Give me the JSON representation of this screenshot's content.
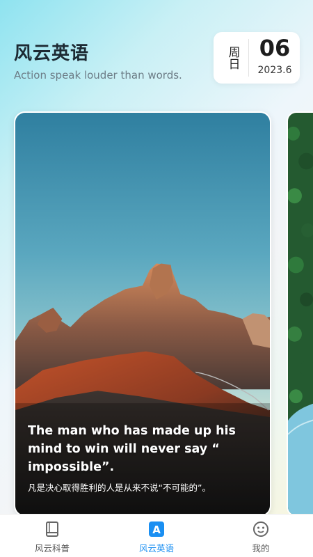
{
  "header": {
    "title": "风云英语",
    "subtitle": "Action speak louder than words."
  },
  "date_card": {
    "weekday": "周日",
    "day": "06",
    "year_month": "2023.6"
  },
  "quote_card": {
    "english": "The man who has made up his mind to win will never say “ impossible”.",
    "chinese": "凡是决心取得胜利的人是从来不说“不可能的”。"
  },
  "tabbar": {
    "tabs": [
      {
        "label": "风云科普",
        "icon": "book-icon",
        "active": false
      },
      {
        "label": "风云英语",
        "icon": "letter-a-icon",
        "active": true
      },
      {
        "label": "我的",
        "icon": "smiley-face-icon",
        "active": false
      }
    ]
  },
  "colors": {
    "accent": "#1a8ff2",
    "title": "#1d2a33",
    "subtitle": "#6c7c86"
  }
}
